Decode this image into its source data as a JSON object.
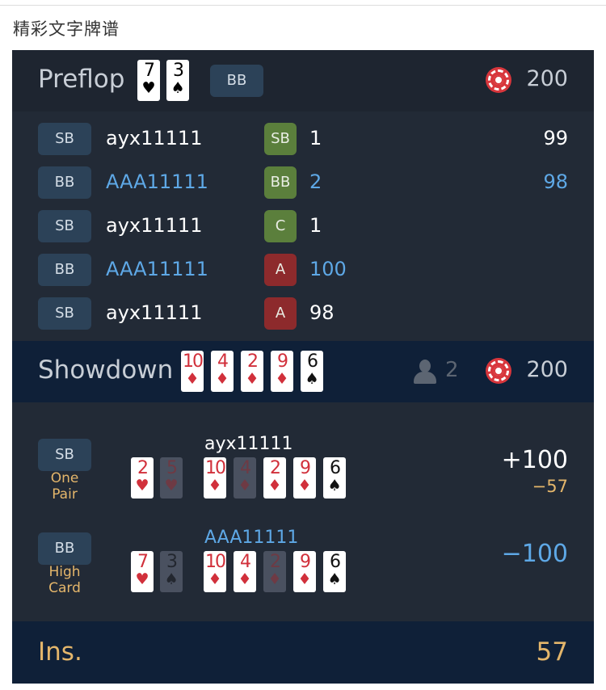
{
  "page": {
    "title": "精彩文字牌谱"
  },
  "preflop": {
    "title": "Preflop",
    "hole_cards": [
      {
        "rank": "7",
        "suit": "♥",
        "color": "red"
      },
      {
        "rank": "3",
        "suit": "♠",
        "color": "black"
      }
    ],
    "position": "BB",
    "pot": "200",
    "actions": [
      {
        "position": "SB",
        "player": "ayx11111",
        "hero": false,
        "action": "SB",
        "action_color": "green",
        "amount": "1",
        "stack": "99"
      },
      {
        "position": "BB",
        "player": "AAA11111",
        "hero": true,
        "action": "BB",
        "action_color": "green",
        "amount": "2",
        "stack": "98"
      },
      {
        "position": "SB",
        "player": "ayx11111",
        "hero": false,
        "action": "C",
        "action_color": "green",
        "amount": "1",
        "stack": ""
      },
      {
        "position": "BB",
        "player": "AAA11111",
        "hero": true,
        "action": "A",
        "action_color": "red",
        "amount": "100",
        "stack": ""
      },
      {
        "position": "SB",
        "player": "ayx11111",
        "hero": false,
        "action": "A",
        "action_color": "red",
        "amount": "98",
        "stack": ""
      }
    ]
  },
  "showdown": {
    "title": "Showdown",
    "board": [
      {
        "rank": "10",
        "suit": "♦",
        "color": "red"
      },
      {
        "rank": "4",
        "suit": "♦",
        "color": "red"
      },
      {
        "rank": "2",
        "suit": "♦",
        "color": "red"
      },
      {
        "rank": "9",
        "suit": "♦",
        "color": "red"
      },
      {
        "rank": "6",
        "suit": "♠",
        "color": "black"
      }
    ],
    "players_count": "2",
    "pot": "200",
    "players": [
      {
        "position": "SB",
        "hand_label_1": "One",
        "hand_label_2": "Pair",
        "name": "ayx11111",
        "hero": false,
        "result": "+100",
        "insurance": "−57",
        "hole": [
          {
            "rank": "2",
            "suit": "♥",
            "color": "red",
            "dim": false
          },
          {
            "rank": "5",
            "suit": "♥",
            "color": "red",
            "dim": true
          }
        ],
        "board": [
          {
            "rank": "10",
            "suit": "♦",
            "color": "red",
            "dim": false
          },
          {
            "rank": "4",
            "suit": "♦",
            "color": "red",
            "dim": true
          },
          {
            "rank": "2",
            "suit": "♦",
            "color": "red",
            "dim": false
          },
          {
            "rank": "9",
            "suit": "♦",
            "color": "red",
            "dim": false
          },
          {
            "rank": "6",
            "suit": "♠",
            "color": "black",
            "dim": false
          }
        ]
      },
      {
        "position": "BB",
        "hand_label_1": "High",
        "hand_label_2": "Card",
        "name": "AAA11111",
        "hero": true,
        "result": "−100",
        "insurance": "",
        "hole": [
          {
            "rank": "7",
            "suit": "♥",
            "color": "red",
            "dim": false
          },
          {
            "rank": "3",
            "suit": "♠",
            "color": "black",
            "dim": true
          }
        ],
        "board": [
          {
            "rank": "10",
            "suit": "♦",
            "color": "red",
            "dim": false
          },
          {
            "rank": "4",
            "suit": "♦",
            "color": "red",
            "dim": false
          },
          {
            "rank": "2",
            "suit": "♦",
            "color": "red",
            "dim": true
          },
          {
            "rank": "9",
            "suit": "♦",
            "color": "red",
            "dim": false
          },
          {
            "rank": "6",
            "suit": "♠",
            "color": "black",
            "dim": false
          }
        ]
      }
    ]
  },
  "insurance": {
    "label": "Ins.",
    "value": "57"
  },
  "colors": {
    "hero": "#5ea8e6",
    "accent": "#e4b66b",
    "chip": "#d8363c",
    "panel": "#222a36",
    "header": "#0f2038"
  },
  "icons": {
    "pot": "poker-chip-icon",
    "players": "person-icon"
  }
}
